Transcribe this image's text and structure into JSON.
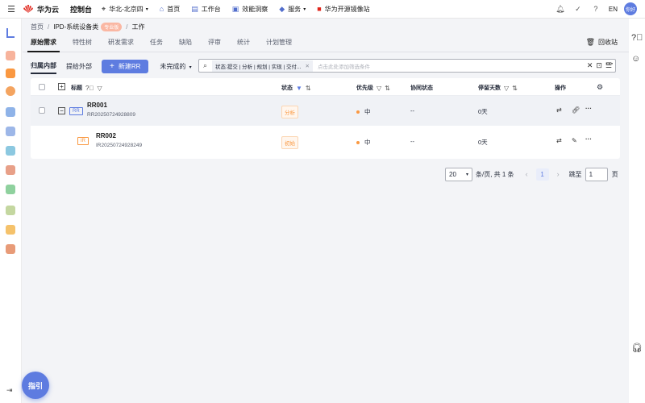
{
  "topbar": {
    "brand": "华为云",
    "console": "控制台",
    "region": "华北-北京四",
    "nav": [
      {
        "label": "首页",
        "icon": "home-icon"
      },
      {
        "label": "工作台",
        "icon": "workbench-icon"
      },
      {
        "label": "效能洞察",
        "icon": "insight-icon"
      },
      {
        "label": "服务",
        "icon": "services-icon"
      },
      {
        "label": "华为开源镜像站",
        "icon": "mirror-icon"
      }
    ],
    "lang": "EN",
    "avatar": "你好"
  },
  "breadcrumb": {
    "home": "首页",
    "project": "IPD-系统设备类",
    "badge": "专业版",
    "current": "工作"
  },
  "tabs": [
    "原始需求",
    "特性树",
    "研发需求",
    "任务",
    "缺陷",
    "评审",
    "统计",
    "计划管理"
  ],
  "recycle": "回收站",
  "filters": {
    "own": "归属内部",
    "external": "提给外部",
    "new_button": "新建RR",
    "status_dropdown": "未完成的",
    "search_tag": "状态:提交 | 分析 | 规划 | 实现 | 交付...",
    "search_placeholder": "点击此处添加筛选条件"
  },
  "table": {
    "headers": {
      "title": "标题",
      "status": "状态",
      "priority": "优先级",
      "collab": "协同状态",
      "days": "停留天数",
      "ops": "操作"
    },
    "rows": [
      {
        "type": "RR",
        "id": "RR001",
        "code": "RR20250724928809",
        "status": "分析",
        "priority": "中",
        "collab": "--",
        "days": "0天"
      },
      {
        "type": "IR",
        "id": "RR002",
        "code": "IR20250724928249",
        "status": "初始",
        "priority": "中",
        "collab": "--",
        "days": "0天"
      }
    ]
  },
  "pagination": {
    "page_size": "20",
    "summary": "条/页, 共 1 条",
    "current_page": "1",
    "goto_label": "跳至",
    "goto_value": "1",
    "page_unit": "页"
  },
  "guide": "指引",
  "colors": {
    "accent": "#5e7ce0",
    "status_analysis": "#fa9841",
    "status_initial": "#fa9841",
    "priority_dot": "#fa9841"
  }
}
